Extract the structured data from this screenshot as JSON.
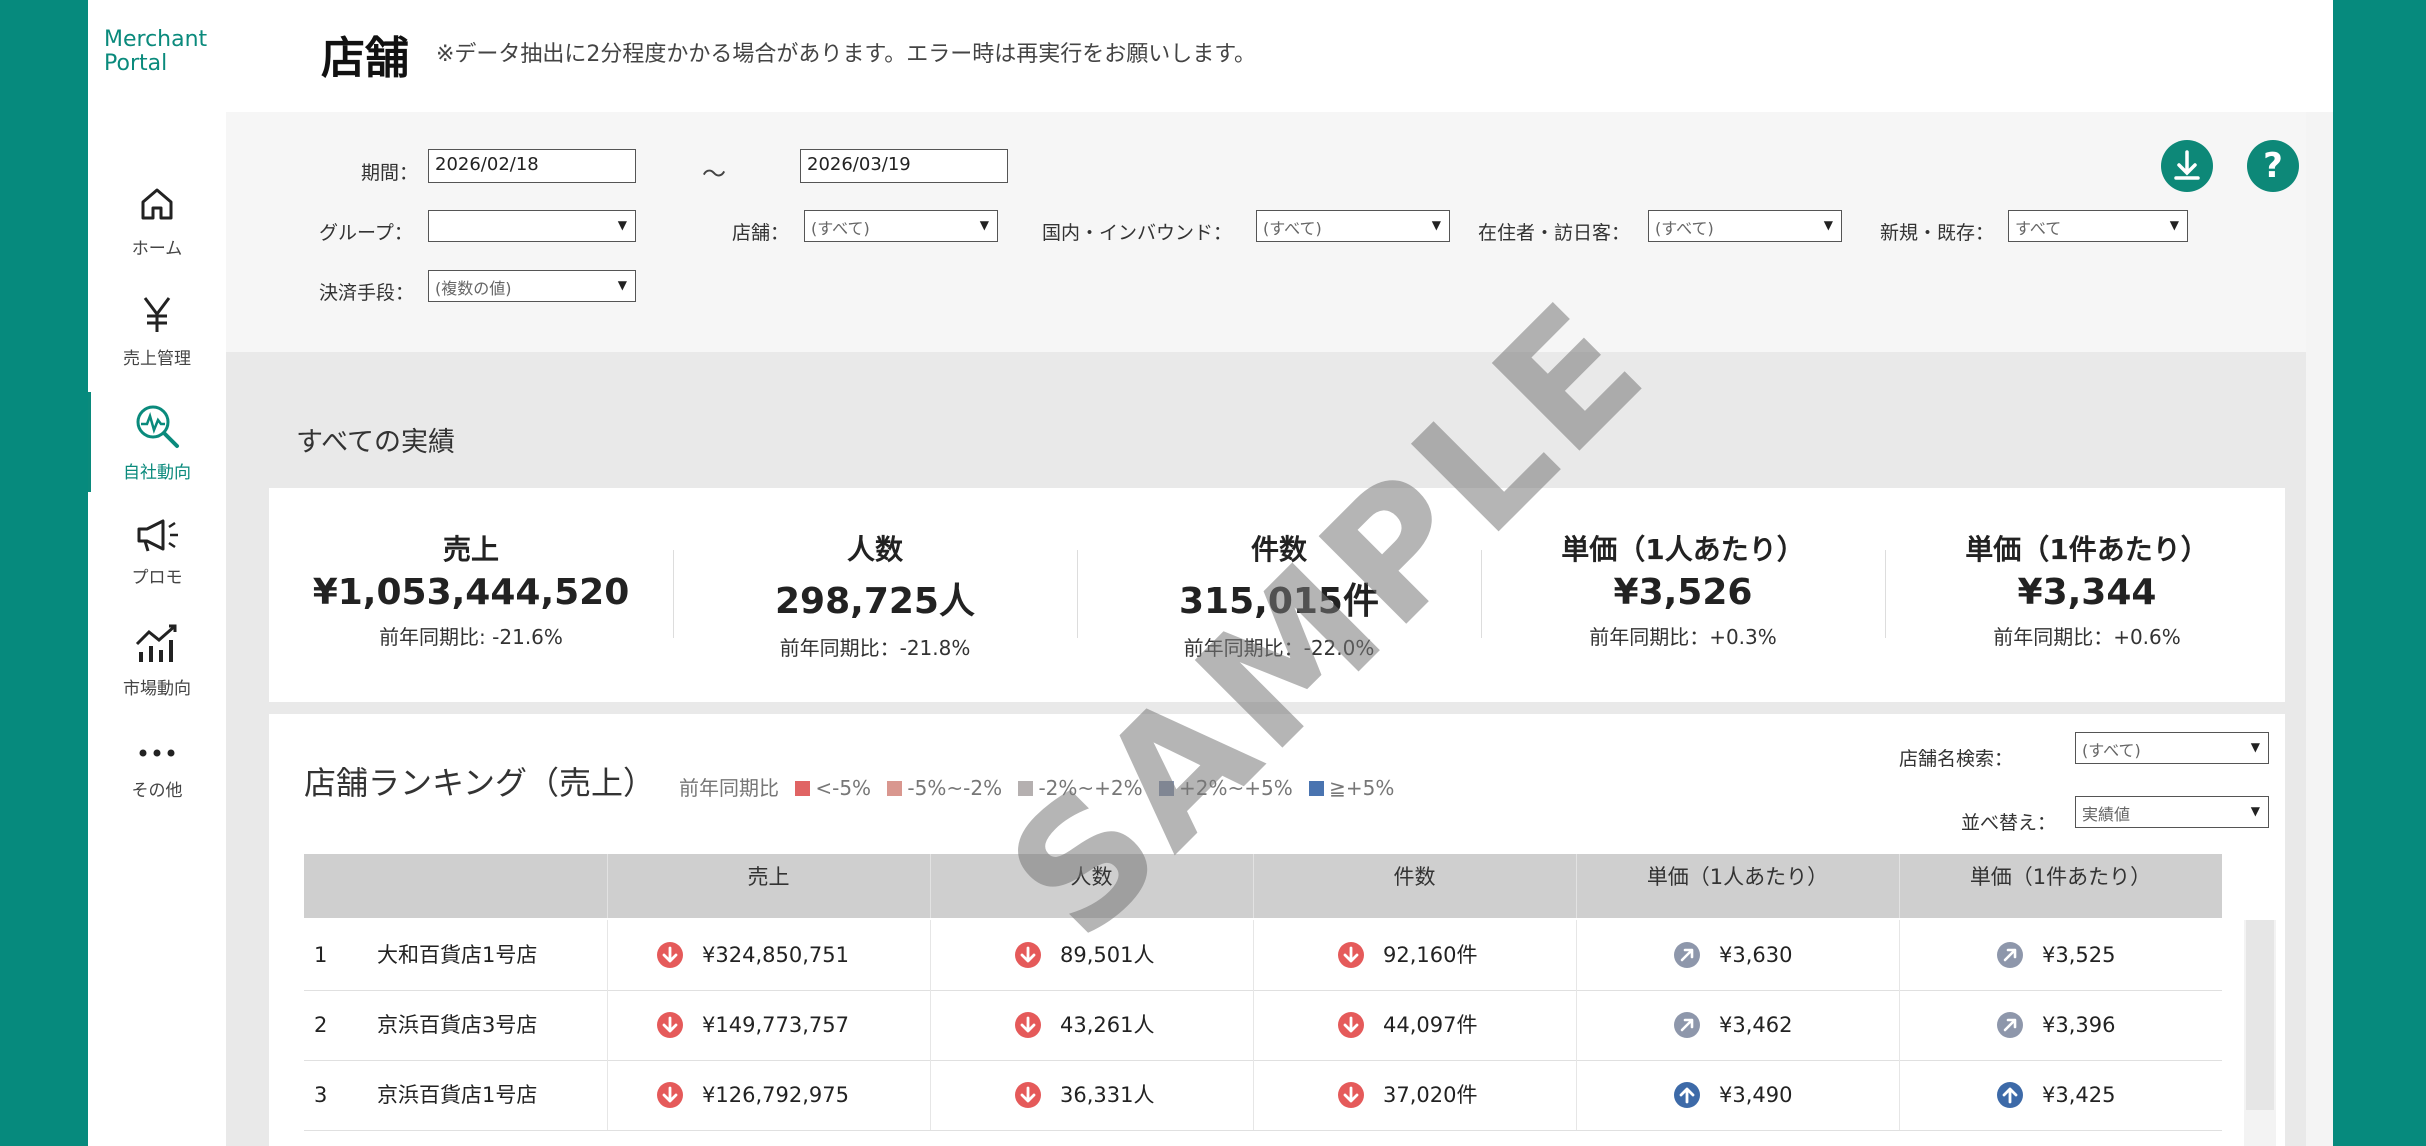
{
  "brand": {
    "line1": "Merchant",
    "line2": "Portal"
  },
  "nav": [
    {
      "label": "ホーム",
      "icon": "home-icon"
    },
    {
      "label": "売上管理",
      "icon": "yen-icon"
    },
    {
      "label": "自社動向",
      "icon": "trend-search-icon"
    },
    {
      "label": "プロモ",
      "icon": "megaphone-icon"
    },
    {
      "label": "市場動向",
      "icon": "market-chart-icon"
    },
    {
      "label": "その他",
      "icon": "more-icon"
    }
  ],
  "header": {
    "title": "店舗",
    "note": "※データ抽出に2分程度かかる場合があります。エラー時は再実行をお願いします。"
  },
  "filters": {
    "period_label": "期間：",
    "start_date": "2026/02/18",
    "tilde": "～",
    "end_date": "2026/03/19",
    "group_label": "グループ：",
    "group_value": "",
    "store_label": "店舗：",
    "store_value": "(すべて)",
    "domestic_label": "国内・インバウンド：",
    "domestic_value": "(すべて)",
    "resident_label": "在住者・訪日客：",
    "resident_value": "(すべて)",
    "newold_label": "新規・既存：",
    "newold_value": "すべて",
    "payment_label": "決済手段：",
    "payment_value": "(複数の値)",
    "download_icon": "⭳",
    "help_icon": "?"
  },
  "summary": {
    "title": "すべての実績",
    "kpis": [
      {
        "title": "売上",
        "value": "¥1,053,444,520",
        "yoy": "前年同期比: -21.6%"
      },
      {
        "title": "人数",
        "value": "298,725人",
        "yoy": "前年同期比：-21.8%"
      },
      {
        "title": "件数",
        "value": "315,015件",
        "yoy": "前年同期比：-22.0%"
      },
      {
        "title": "単価（1人あたり）",
        "value": "¥3,526",
        "yoy": "前年同期比：+0.3%"
      },
      {
        "title": "単価（1件あたり）",
        "value": "¥3,344",
        "yoy": "前年同期比：+0.6%"
      }
    ]
  },
  "ranking": {
    "title": "店舗ランキング（売上）",
    "legend_prefix": "前年同期比",
    "legend": [
      {
        "label": "<-5%",
        "color": "#e06464"
      },
      {
        "label": "-5%~-2%",
        "color": "#d9978f"
      },
      {
        "label": "-2%~+2%",
        "color": "#b5b0b0"
      },
      {
        "label": "+2%~+5%",
        "color": "#8a98b4"
      },
      {
        "label": "≧+5%",
        "color": "#4a74b0"
      }
    ],
    "search_label": "店舗名検索：",
    "search_value": "(すべて)",
    "sort_label": "並べ替え：",
    "sort_value": "実績値",
    "columns": [
      "売上",
      "人数",
      "件数",
      "単価（1人あたり）",
      "単価（1件あたり）"
    ],
    "rows": [
      {
        "rank": "1",
        "name": "大和百貨店1号店",
        "sales": "¥324,850,751",
        "people": "89,501人",
        "count": "92,160件",
        "per_person": "¥3,630",
        "per_txn": "¥3,525",
        "icons": [
          "down-red",
          "down-red",
          "down-red",
          "diag-gray",
          "diag-gray"
        ]
      },
      {
        "rank": "2",
        "name": "京浜百貨店3号店",
        "sales": "¥149,773,757",
        "people": "43,261人",
        "count": "44,097件",
        "per_person": "¥3,462",
        "per_txn": "¥3,396",
        "icons": [
          "down-red",
          "down-red",
          "down-red",
          "diag-gray",
          "diag-gray"
        ]
      },
      {
        "rank": "3",
        "name": "京浜百貨店1号店",
        "sales": "¥126,792,975",
        "people": "36,331人",
        "count": "37,020件",
        "per_person": "¥3,490",
        "per_txn": "¥3,425",
        "icons": [
          "down-red",
          "down-red",
          "down-red",
          "up-blue",
          "up-blue"
        ]
      }
    ]
  },
  "watermark": "SAMPLE",
  "colors": {
    "accent": "#0a8a7c",
    "down": "#e55a5a",
    "up": "#3d6aa8",
    "neutral": "#8e97ab"
  }
}
